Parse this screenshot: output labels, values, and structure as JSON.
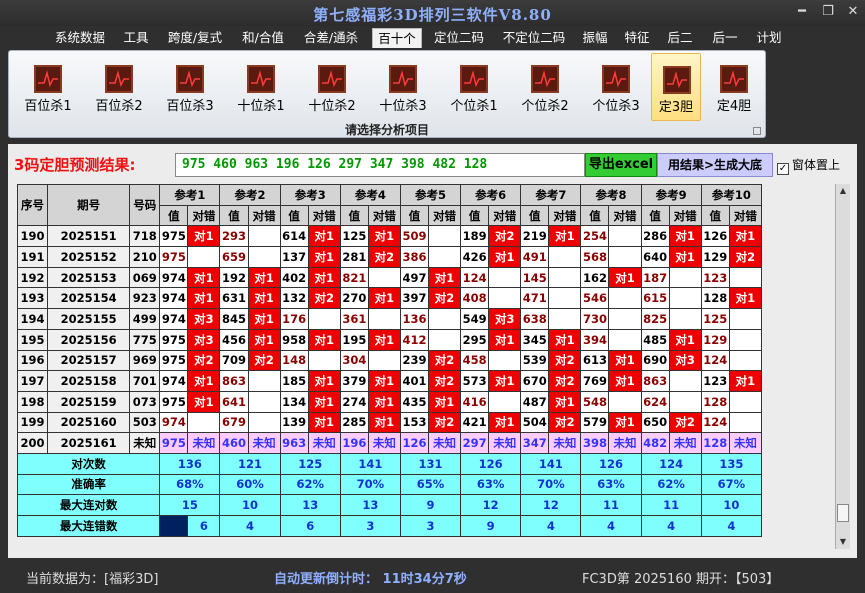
{
  "window": {
    "title": "第七感福彩3D排列三软件V8.80",
    "minimize": "━",
    "restore": "❐",
    "close": "✕"
  },
  "menu": [
    "系统数据",
    "工具",
    "跨度/复式",
    "和/合值",
    "合差/通杀",
    "百十个",
    "定位二码",
    "不定位二码",
    "振幅",
    "特征",
    "后二",
    "后一",
    "计划"
  ],
  "active_menu": 5,
  "ribbon": {
    "buttons": [
      "百位杀1",
      "百位杀2",
      "百位杀3",
      "十位杀1",
      "十位杀2",
      "十位杀3",
      "个位杀1",
      "个位杀2",
      "个位杀3",
      "定3胆",
      "定4胆"
    ],
    "selected": 9,
    "caption": "请选择分析项目",
    "icon": "chart-icon"
  },
  "prediction": {
    "label": "3码定胆预测结果:",
    "value": "975 460 963 196 126 297 347 398 482 128",
    "excel_button": "导出excel",
    "gen_button": "用结果>生成大底",
    "topmost_label": "窗体置上",
    "topmost_checked": "✓"
  },
  "table": {
    "h_seq": "序号",
    "h_issue": "期号",
    "h_code": "号码",
    "refs": [
      "参考1",
      "参考2",
      "参考3",
      "参考4",
      "参考5",
      "参考6",
      "参考7",
      "参考8",
      "参考9",
      "参考10"
    ],
    "sub_val": "值",
    "sub_hit": "对错",
    "rows": [
      {
        "seq": "190",
        "issue": "2025151",
        "code": "718",
        "vals": [
          "975",
          "293",
          "614",
          "125",
          "509",
          "189",
          "219",
          "254",
          "286",
          "126"
        ],
        "hits": [
          "对1",
          "",
          "对1",
          "对1",
          "",
          "对2",
          "对1",
          "",
          "对1",
          "对1"
        ]
      },
      {
        "seq": "191",
        "issue": "2025152",
        "code": "210",
        "vals": [
          "975",
          "659",
          "137",
          "281",
          "386",
          "426",
          "491",
          "568",
          "640",
          "129"
        ],
        "hits": [
          "",
          "",
          "对1",
          "对2",
          "",
          "对1",
          "",
          "",
          "对1",
          "对2"
        ]
      },
      {
        "seq": "192",
        "issue": "2025153",
        "code": "069",
        "vals": [
          "974",
          "192",
          "402",
          "821",
          "497",
          "124",
          "145",
          "162",
          "187",
          "123"
        ],
        "hits": [
          "对1",
          "对1",
          "对1",
          "",
          "对1",
          "",
          "",
          "对1",
          "",
          ""
        ]
      },
      {
        "seq": "193",
        "issue": "2025154",
        "code": "923",
        "vals": [
          "974",
          "631",
          "132",
          "270",
          "397",
          "408",
          "471",
          "546",
          "615",
          "128"
        ],
        "hits": [
          "对1",
          "对1",
          "对2",
          "对1",
          "对2",
          "",
          "",
          "",
          "",
          "对1"
        ]
      },
      {
        "seq": "194",
        "issue": "2025155",
        "code": "499",
        "vals": [
          "974",
          "845",
          "176",
          "361",
          "136",
          "549",
          "638",
          "730",
          "825",
          "125"
        ],
        "hits": [
          "对3",
          "对1",
          "",
          "",
          "",
          "对3",
          "",
          "",
          "",
          ""
        ]
      },
      {
        "seq": "195",
        "issue": "2025156",
        "code": "775",
        "vals": [
          "975",
          "456",
          "958",
          "195",
          "412",
          "295",
          "345",
          "394",
          "485",
          "129"
        ],
        "hits": [
          "对3",
          "对1",
          "对1",
          "对1",
          "",
          "对1",
          "对1",
          "",
          "对1",
          ""
        ]
      },
      {
        "seq": "196",
        "issue": "2025157",
        "code": "969",
        "vals": [
          "975",
          "709",
          "148",
          "304",
          "239",
          "458",
          "539",
          "613",
          "690",
          "124"
        ],
        "hits": [
          "对2",
          "对2",
          "",
          "",
          "对2",
          "",
          "对2",
          "对1",
          "对3",
          ""
        ]
      },
      {
        "seq": "197",
        "issue": "2025158",
        "code": "701",
        "vals": [
          "974",
          "863",
          "185",
          "379",
          "401",
          "573",
          "670",
          "769",
          "863",
          "123"
        ],
        "hits": [
          "对1",
          "",
          "对1",
          "对1",
          "对2",
          "对1",
          "对2",
          "对1",
          "",
          "对1"
        ]
      },
      {
        "seq": "198",
        "issue": "2025159",
        "code": "073",
        "vals": [
          "975",
          "641",
          "134",
          "274",
          "435",
          "416",
          "487",
          "548",
          "624",
          "128"
        ],
        "hits": [
          "对1",
          "",
          "对1",
          "对1",
          "对1",
          "",
          "对1",
          "",
          "",
          ""
        ]
      },
      {
        "seq": "199",
        "issue": "2025160",
        "code": "503",
        "vals": [
          "974",
          "679",
          "139",
          "285",
          "153",
          "421",
          "504",
          "579",
          "650",
          "124"
        ],
        "hits": [
          "",
          "",
          "对1",
          "对1",
          "对2",
          "对1",
          "对2",
          "对1",
          "对2",
          ""
        ]
      },
      {
        "seq": "200",
        "issue": "2025161",
        "code": "未知",
        "vals": [
          "975",
          "460",
          "963",
          "196",
          "126",
          "297",
          "347",
          "398",
          "482",
          "128"
        ],
        "hits": [
          "未知",
          "未知",
          "未知",
          "未知",
          "未知",
          "未知",
          "未知",
          "未知",
          "未知",
          "未知"
        ]
      }
    ],
    "stats": [
      {
        "label": "对次数",
        "values": [
          "136",
          "121",
          "125",
          "141",
          "131",
          "126",
          "141",
          "126",
          "124",
          "135"
        ]
      },
      {
        "label": "准确率",
        "values": [
          "68%",
          "60%",
          "62%",
          "70%",
          "65%",
          "63%",
          "70%",
          "63%",
          "62%",
          "67%"
        ]
      },
      {
        "label": "最大连对数",
        "values": [
          "15",
          "10",
          "13",
          "13",
          "9",
          "12",
          "12",
          "11",
          "11",
          "10"
        ]
      },
      {
        "label": "最大连错数",
        "values": [
          "6",
          "4",
          "6",
          "3",
          "3",
          "9",
          "4",
          "4",
          "4",
          "4"
        ]
      }
    ]
  },
  "status": {
    "data_source": "当前数据为：[福彩3D]",
    "countdown": "自动更新倒计时： 11时34分7秒",
    "lottery": "FC3D第 2025160 期开：【503】"
  },
  "colors": {
    "hit": "#ee0000",
    "stats_bg": "#80ffff",
    "unknown_row": "#ffccff",
    "prediction_text": "#009900",
    "label_red": "#ee1111"
  }
}
